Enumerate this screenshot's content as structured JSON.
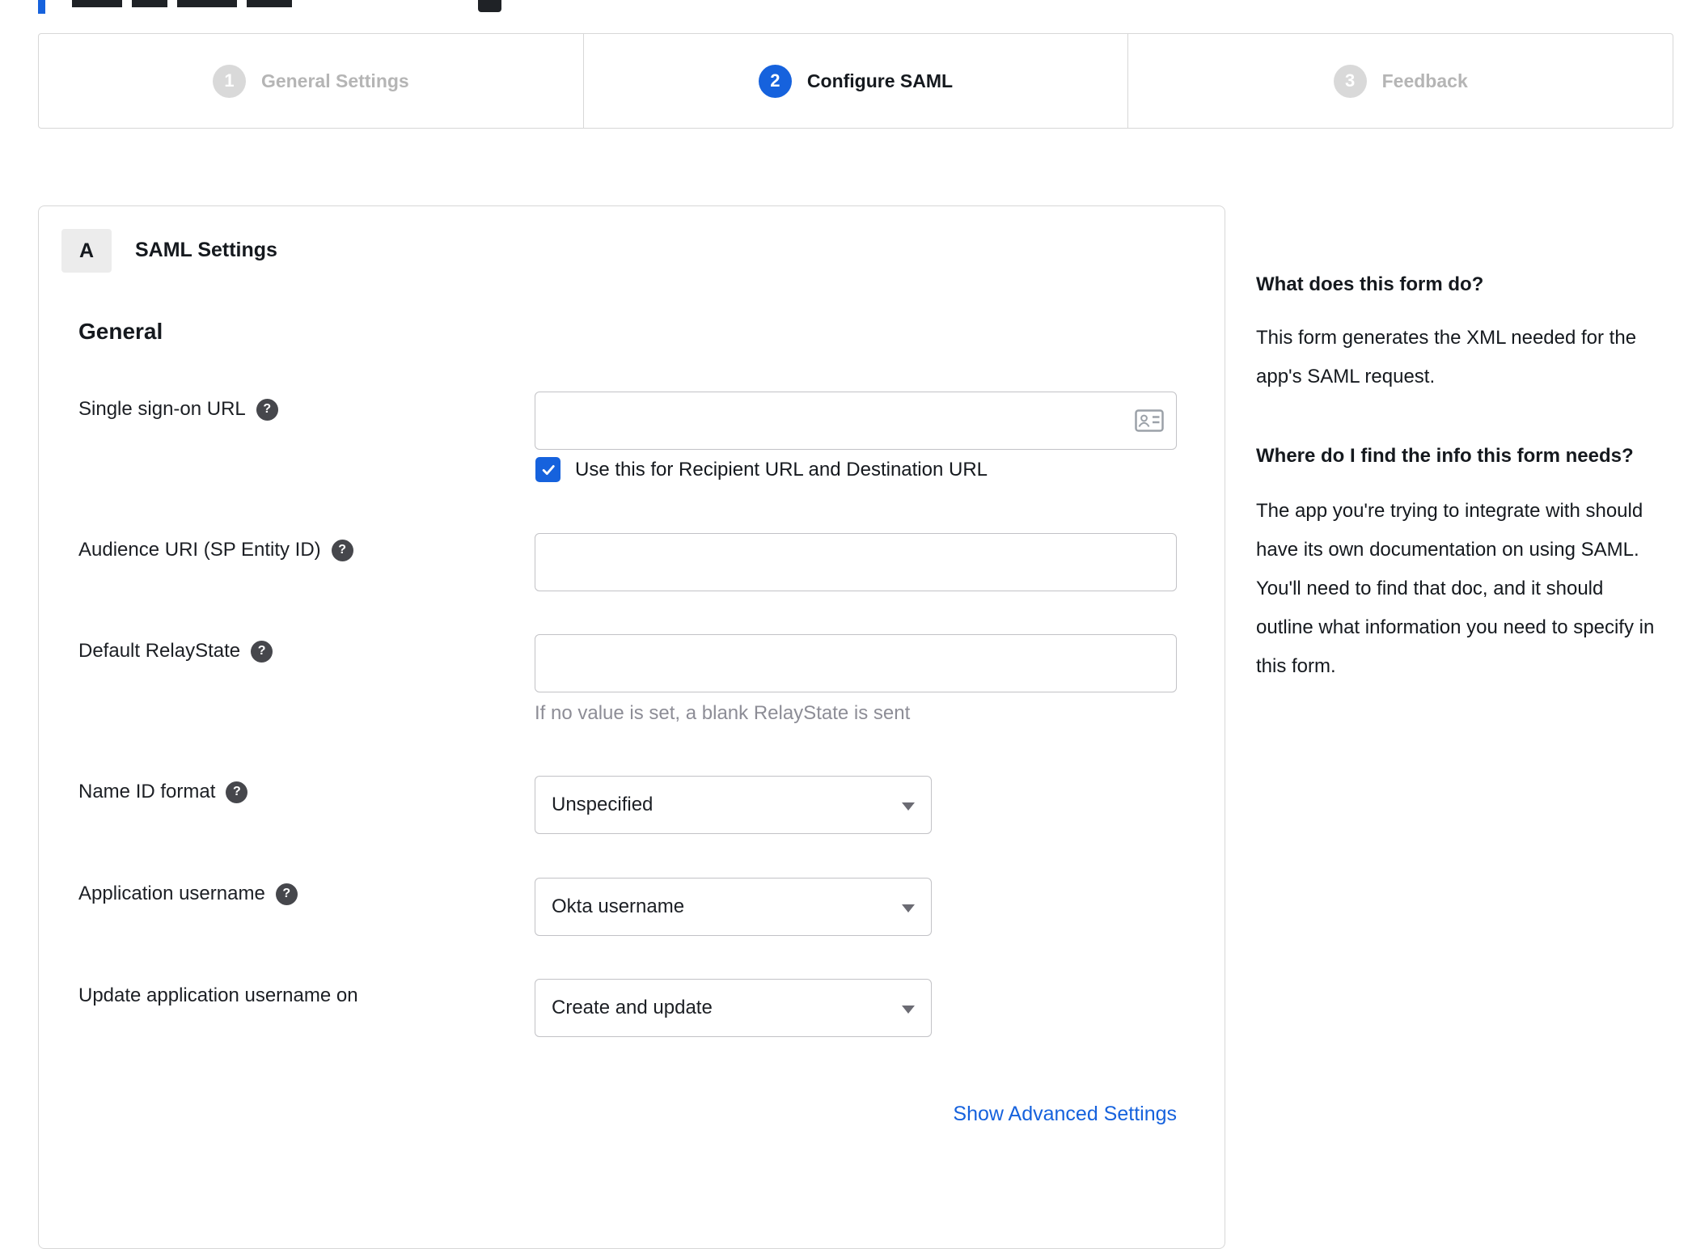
{
  "accent": "#1662dd",
  "glyphs": {
    "help": "?"
  },
  "stepper": {
    "active_step": "2",
    "steps": [
      {
        "number": "1",
        "label": "General Settings"
      },
      {
        "number": "2",
        "label": "Configure SAML"
      },
      {
        "number": "3",
        "label": "Feedback"
      }
    ]
  },
  "panel": {
    "badge": "A",
    "title": "SAML Settings",
    "section_heading": "General",
    "sso": {
      "label": "Single sign-on URL",
      "value": "",
      "checkbox_checked": true,
      "checkbox_label": "Use this for Recipient URL and Destination URL"
    },
    "audience": {
      "label": "Audience URI (SP Entity ID)",
      "value": ""
    },
    "relay_state": {
      "label": "Default RelayState",
      "value": "",
      "helper": "If no value is set, a blank RelayState is sent"
    },
    "name_id": {
      "label": "Name ID format",
      "selected": "Unspecified"
    },
    "app_username": {
      "label": "Application username",
      "selected": "Okta username"
    },
    "update_username": {
      "label": "Update application username on",
      "selected": "Create and update"
    },
    "advanced_link": "Show Advanced Settings"
  },
  "help_panel": {
    "heading1": "What does this form do?",
    "body1": "This form generates the XML needed for the app's SAML request.",
    "heading2": "Where do I find the info this form needs?",
    "body2": "The app you're trying to integrate with should have its own documentation on using SAML. You'll need to find that doc, and it should outline what information you need to specify in this form."
  }
}
